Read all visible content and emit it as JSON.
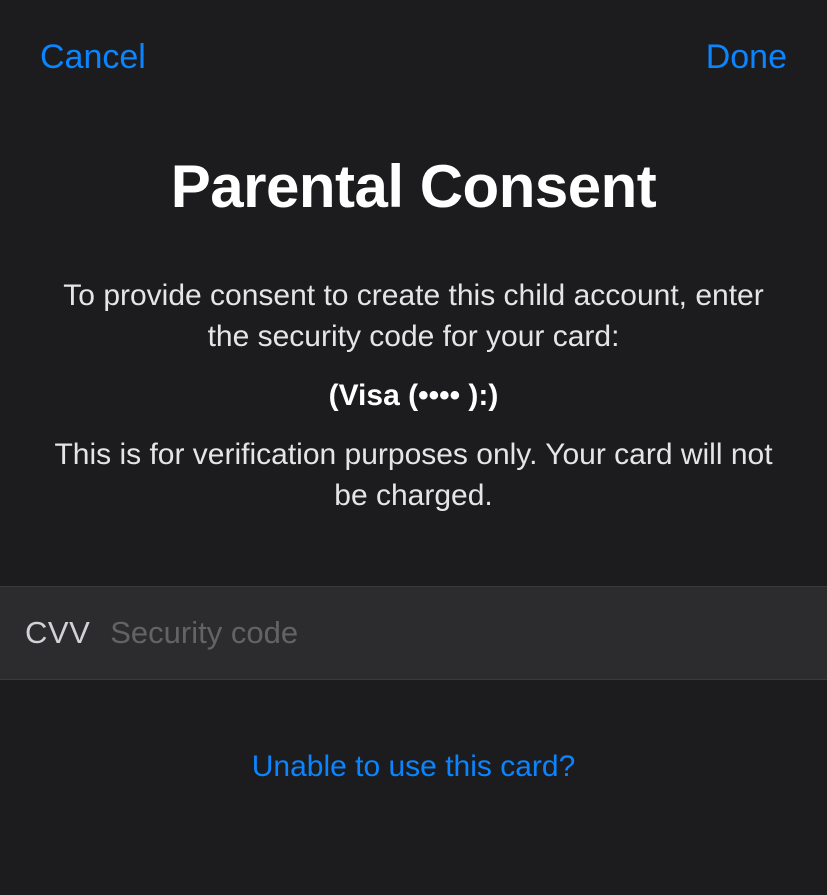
{
  "navbar": {
    "cancel": "Cancel",
    "done": "Done"
  },
  "main": {
    "title": "Parental Consent",
    "description": "To provide consent to create this child account, enter the security code for your card:",
    "card_info": "(Visa (•••• ):)",
    "notice": "This is for verification purposes only. Your card will not be charged.",
    "cvv_label": "CVV",
    "cvv_placeholder": "Security code",
    "cvv_value": "",
    "unable_link": "Unable to use this card?"
  }
}
